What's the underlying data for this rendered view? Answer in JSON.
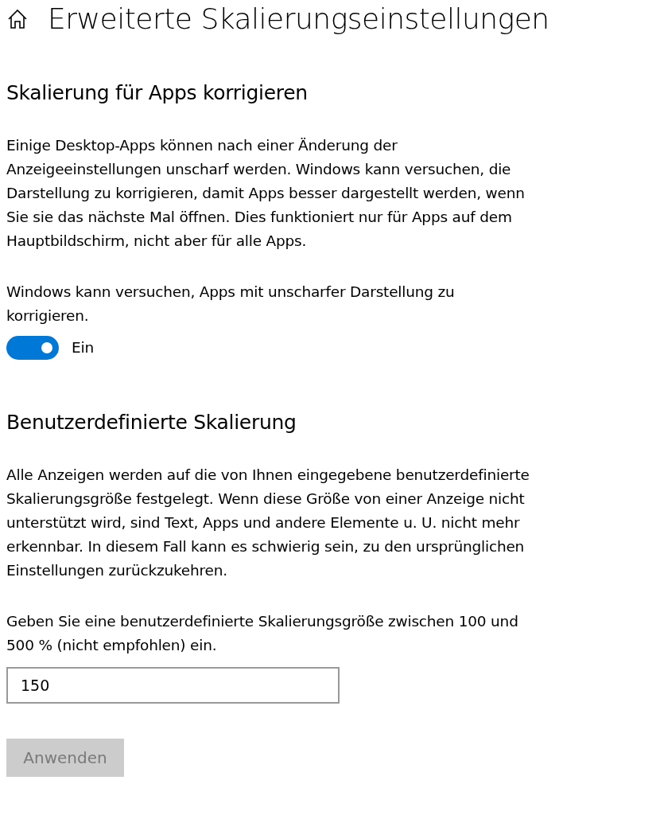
{
  "title": "Erweiterte Skalierungseinstellungen",
  "sections": [
    {
      "kind": "toggle",
      "heading": "Skalierung für Apps korrigieren",
      "description": "Einige Desktop-Apps können nach einer Änderung der Anzeigeeinstellungen unscharf werden. Windows kann versuchen, die Darstellung zu korrigieren, damit Apps besser dargestellt werden, wenn Sie sie das nächste Mal öffnen. Dies funktioniert nur für Apps auf dem Hauptbildschirm, nicht aber für alle Apps.",
      "prompt": "Windows kann versuchen, Apps mit unscharfer Darstellung zu korrigieren.",
      "toggle": {
        "on": true,
        "label": "Ein"
      }
    },
    {
      "kind": "input",
      "heading": "Benutzerdefinierte Skalierung",
      "description": "Alle Anzeigen werden auf die von Ihnen eingegebene benutzerdefinierte Skalierungsgröße festgelegt. Wenn diese Größe von einer Anzeige nicht unterstützt wird, sind Text, Apps und andere Elemente u. U. nicht mehr erkennbar. In diesem Fall kann es schwierig sein, zu den ursprünglichen Einstellungen zurückzukehren.",
      "prompt": "Geben Sie eine benutzerdefinierte Skalierungsgröße zwischen 100 und 500 % (nicht empfohlen) ein.",
      "input": {
        "value": "150"
      },
      "button": {
        "label": "Anwenden",
        "disabled": true
      }
    }
  ]
}
